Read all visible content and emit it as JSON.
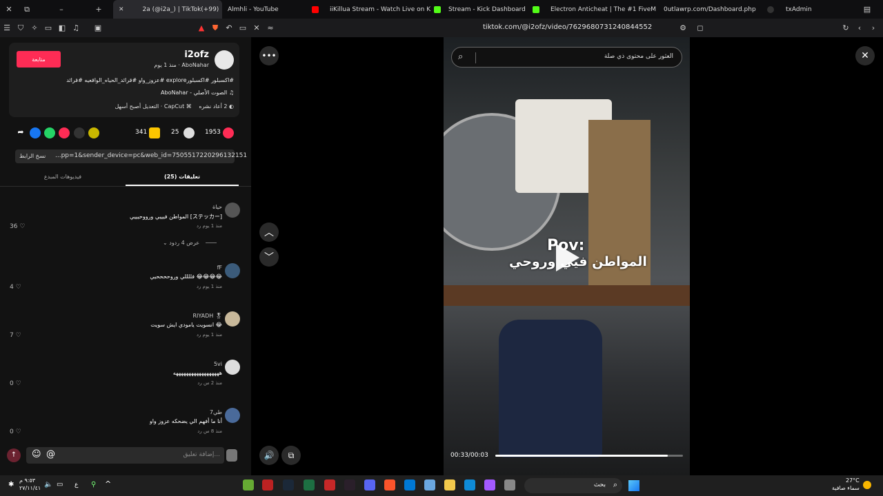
{
  "browser": {
    "tabs": [
      {
        "title": "2a (@i2a_) | TikTok(+99)",
        "color": "#ffffff"
      },
      {
        "title": "Almhli - YouTube",
        "color": "#ff0000"
      },
      {
        "title": "iiKillua Stream - Watch Live on K",
        "color": "#53fc18"
      },
      {
        "title": "Stream - Kick Dashboard",
        "color": "#53fc18"
      },
      {
        "title": "Electron Anticheat | The #1 FiveM A",
        "color": "#1e88e5"
      },
      {
        "title": "0utlawrp.com/Dashboard.php",
        "color": "#888888"
      },
      {
        "title": "txAdmin",
        "color": "#9c6bff"
      }
    ],
    "url": "tiktok.com/@i2ofz/video/7629680731240844552"
  },
  "post": {
    "follow_label": "متابعة",
    "username": "i2ofz",
    "meta": "AboNahar · منذ 1 يوم",
    "hashtags": "#اكسبلور #اكسبلورexplore #عزوز_واو #قرائد_الحياه_الواقعيه #قرائد",
    "sound": "الصوت الأصلي - AboNahar",
    "capcut": "CapCut · التعديل أصبح أسهل",
    "shares_text": "2 أعاد نشره",
    "likes": "1953",
    "comments": "25",
    "saves": "341",
    "link": "...pp=1&sender_device=pc&web_id=7505517220296132151",
    "copy_link": "نسخ الرابط",
    "tab_comments": "تعليقات (25)",
    "tab_creator": "فيديوهات المبدع"
  },
  "comments": [
    {
      "name": "حياة",
      "text": "المواطن فيييي ورووحيييي [ステッカー]",
      "meta": "منذ 1 يوم   رد",
      "likes": "36"
    },
    {
      "name": "fF",
      "text": "فللللي وروححححيي 😂😂😂😂",
      "meta": "منذ 1 يوم   رد",
      "likes": "4"
    },
    {
      "name": "RIYADH 🎖",
      "text": "انسويت يامودي ايش سويت 😂",
      "meta": "منذ 1 يوم   رد",
      "likes": "7"
    },
    {
      "name": "5vi",
      "text": "ههههههههههههههههههه",
      "meta": "منذ 2 س   رد",
      "likes": "0"
    },
    {
      "name": "طي7",
      "text": "أنا ما أفهم الي يضحكه عزوز واو",
      "meta": "منذ 8 س   رد",
      "likes": "0"
    }
  ],
  "replies_label": "عرض 4 ردود",
  "input_placeholder": "إضافة تعليق...",
  "video": {
    "search_placeholder": "العثور على محتوى ذي صلة",
    "pov": "Pov:",
    "caption": "المواطن فيي وروحي",
    "time": "00:33/00:03",
    "progress": 0.92
  },
  "taskbar": {
    "search_label": "بحث",
    "weather_temp": "27°C",
    "weather_text": "سماء صافية",
    "clock_time": "٩:٥٣ م",
    "clock_date": "٢٧/١١/٤١",
    "lang": "ع"
  }
}
